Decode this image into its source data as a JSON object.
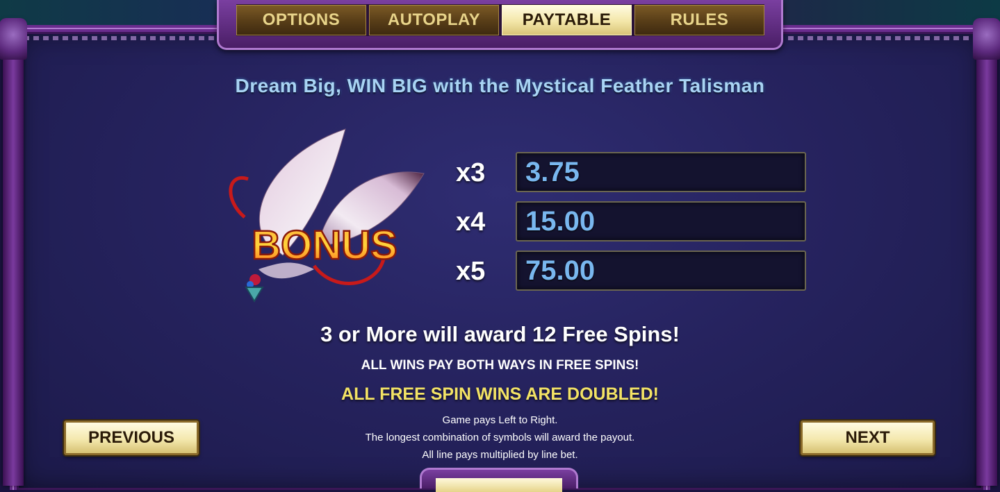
{
  "tabs": [
    {
      "label": "OPTIONS",
      "active": false
    },
    {
      "label": "AUTOPLAY",
      "active": false
    },
    {
      "label": "PAYTABLE",
      "active": true
    },
    {
      "label": "RULES",
      "active": false
    }
  ],
  "headline": "Dream Big, WIN BIG with the Mystical Feather Talisman",
  "symbol": {
    "label": "BONUS",
    "icon": "feather-talisman-bonus-icon"
  },
  "payouts": [
    {
      "multiplier": "x3",
      "value": "3.75"
    },
    {
      "multiplier": "x4",
      "value": "15.00"
    },
    {
      "multiplier": "x5",
      "value": "75.00"
    }
  ],
  "info": {
    "free_spins": "3 or More will award 12 Free Spins!",
    "both_ways": "ALL WINS PAY BOTH WAYS IN FREE SPINS!",
    "doubled": "ALL FREE SPIN WINS ARE DOUBLED!",
    "rules": [
      "Game pays Left to Right.",
      "The longest combination of symbols will award the payout.",
      "All line pays multiplied by line bet."
    ]
  },
  "nav": {
    "previous_label": "PREVIOUS",
    "next_label": "NEXT"
  },
  "colors": {
    "panel": "#26235f",
    "frame": "#6a2c8e",
    "headline": "#a9d4f4",
    "payout_value": "#79b7ef",
    "highlight": "#f3e365"
  }
}
